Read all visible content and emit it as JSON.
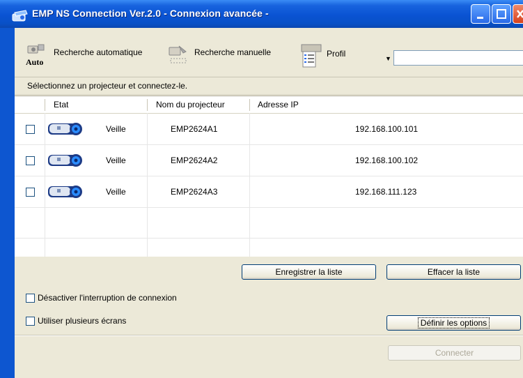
{
  "window": {
    "title": "EMP NS Connection Ver.2.0 - Connexion avancée -"
  },
  "toolbar": {
    "auto_search_label": "Recherche automatique",
    "auto_search_icon_caption": "Auto",
    "manual_search_label": "Recherche manuelle",
    "profile_label": "Profil",
    "profile_combo_value": ""
  },
  "instruction": "Sélectionnez un projecteur et connectez-le.",
  "table": {
    "headers": {
      "status": "Etat",
      "name": "Nom du projecteur",
      "ip": "Adresse IP"
    },
    "rows": [
      {
        "checked": false,
        "status": "Veille",
        "name": "EMP2624A1",
        "ip": "192.168.100.101"
      },
      {
        "checked": false,
        "status": "Veille",
        "name": "EMP2624A2",
        "ip": "192.168.100.102"
      },
      {
        "checked": false,
        "status": "Veille",
        "name": "EMP2624A3",
        "ip": "192.168.111.123"
      }
    ]
  },
  "buttons": {
    "save_list": "Enregistrer la liste",
    "clear_list": "Effacer la liste",
    "set_options": "Définir les options",
    "connect": "Connecter"
  },
  "options": {
    "disable_interrupt_label": "Désactiver l'interruption de connexion",
    "disable_interrupt_checked": false,
    "multi_screen_label": "Utiliser plusieurs écrans",
    "multi_screen_checked": false
  },
  "colors": {
    "titlebar": "#0a53d3",
    "window_bg": "#ece9d8",
    "projector_body": "#1d3b86",
    "projector_lens": "#2a8cff"
  }
}
